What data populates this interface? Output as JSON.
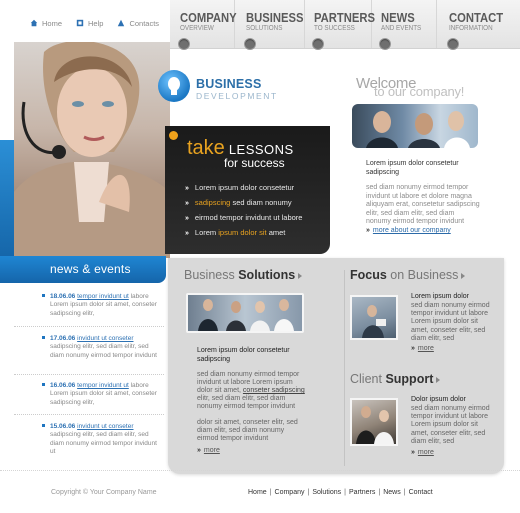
{
  "utility": [
    {
      "label": "Home",
      "icon": "home-icon"
    },
    {
      "label": "Help",
      "icon": "help-icon"
    },
    {
      "label": "Contacts",
      "icon": "contacts-icon"
    }
  ],
  "nav": [
    {
      "title": "COMPANY",
      "sub": "OVERVIEW"
    },
    {
      "title": "BUSINESS",
      "sub": "SOLUTIONS"
    },
    {
      "title": "PARTNERS",
      "sub": "TO SUCCESS"
    },
    {
      "title": "NEWS",
      "sub": "AND EVENTS"
    },
    {
      "title": "CONTACT",
      "sub": "INFORMATION"
    }
  ],
  "lessons": {
    "take": "take",
    "lessons": "LESSONS",
    "for_success": "for success",
    "items": [
      {
        "pre": "",
        "hl": "",
        "post": "Lorem ipsum dolor consetetur"
      },
      {
        "pre": "",
        "hl": "sadipscing",
        "post": " sed diam nonumy"
      },
      {
        "pre": "",
        "hl": "",
        "post": "eirmod tempor invidunt ut labore"
      },
      {
        "pre": "Lorem ",
        "hl": "ipsum dolor sit",
        "post": " amet"
      }
    ]
  },
  "logo": {
    "line1": "BUSINESS",
    "line2": "DEVELOPMENT"
  },
  "welcome": {
    "line1": "Welcome",
    "line2": "to our company!",
    "intro": "Lorem ipsum dolor consetetur sadipscing",
    "body": "sed diam nonumy eirmod tempor invidunt ut labore et dolore magna aliquyam erat, consetetur sadipscing elitr, sed diam elitr, sed diam nonumy eirmod tempor invidunt",
    "more": "more about our company",
    "more_glyph": "»"
  },
  "news": {
    "title": "news & events",
    "items": [
      {
        "date": "18.06.06",
        "link": "tempor invidunt ut",
        "text": "labore Lorem ipsum dolor sit amet, conseter sadipscing elitr,"
      },
      {
        "date": "17.06.06",
        "link": "invidunt ut conseter",
        "text": "sadipscing elitr, sed diam elitr, sed diam nonumy eirmod tempor invidunt"
      },
      {
        "date": "16.06.06",
        "link": "tempor invidunt ut",
        "text": "labore Lorem ipsum dolor sit amet, conseter sadipscing elitr,"
      },
      {
        "date": "15.06.06",
        "link": "invidunt ut conseter",
        "text": "sadipscing elitr, sed diam elitr, sed diam nonumy eirmod tempor invidunt ut"
      }
    ]
  },
  "solutions": {
    "head_a": "Business",
    "head_b": "Solutions",
    "title": "Lorem ipsum dolor consetetur sadipscing",
    "body1_a": "sed diam nonumy eirmod tempor invidunt ut labore Lorem ipsum dolor sit amet, ",
    "body1_link": "conseter sadipscing",
    "body1_b": " elitr, sed diam elitr, sed diam nonumy eirmod tempor invidunt",
    "body2": "dolor sit amet, conseter elitr, sed diam elitr, sed diam nonumy eirmod tempor invidunt",
    "more": "more"
  },
  "focus": {
    "head_a": "Focus",
    "head_b": "on Business",
    "title": "Lorem ipsum dolor",
    "body": "sed diam nonumy eirmod tempor invidunt ut labore Lorem ipsum dolor sit amet, conseter elitr, sed diam elitr, sed",
    "more": "more"
  },
  "client": {
    "head_a": "Client",
    "head_b": "Support",
    "title": "Dolor ipsum dolor",
    "body": "sed diam nonumy eirmod tempor invidunt ut labore Lorem ipsum dolor sit amet, conseter elitr, sed diam elitr, sed",
    "more": "more"
  },
  "footer": {
    "copyright": "Copyright © Your Company Name",
    "links": [
      "Home",
      "Company",
      "Solutions",
      "Partners",
      "News",
      "Contact"
    ]
  },
  "colors": {
    "accent_blue": "#1e78c4",
    "orange": "#e9a320",
    "panel_grey": "#d9d9d9"
  }
}
